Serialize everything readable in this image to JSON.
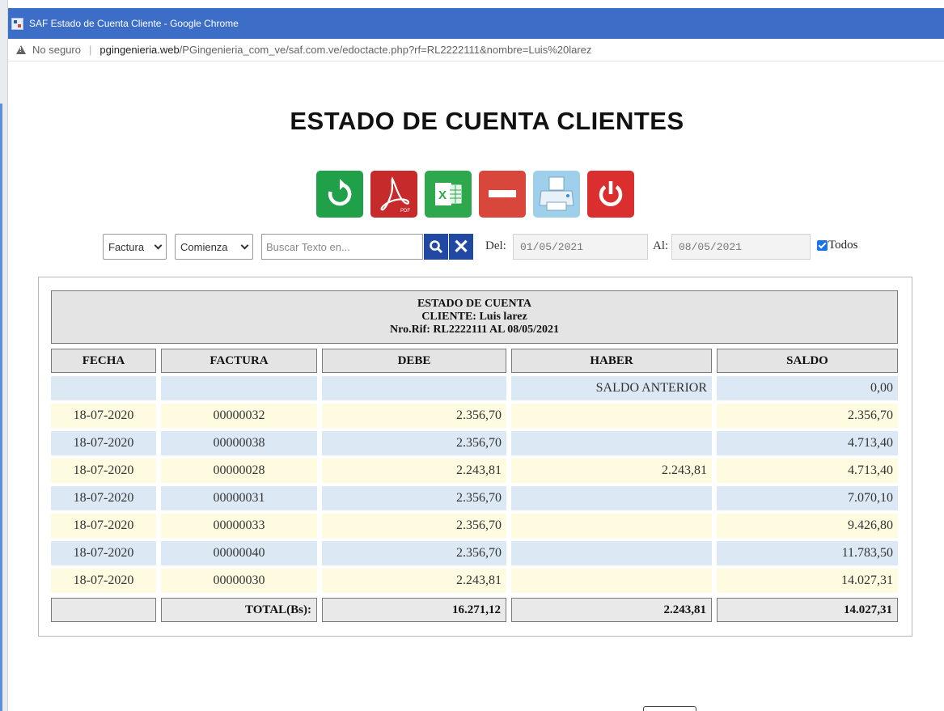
{
  "window": {
    "title": "SAF Estado de Cuenta Cliente - Google Chrome",
    "security": "No seguro",
    "url_host": "pgingenieria.web",
    "url_path": "/PGingenieria_com_ve/saf.com.ve/edoctacte.php?rf=RL2222111&nombre=Luis%20larez"
  },
  "page": {
    "title": "ESTADO DE CUENTA CLIENTES"
  },
  "toolbar": {
    "buttons": [
      "refresh-icon",
      "pdf-icon",
      "excel-icon",
      "minus-icon",
      "print-icon",
      "power-icon"
    ],
    "colors": {
      "refresh": "#21a04a",
      "pdf": "#c62a2b",
      "excel": "#2ea84d",
      "minus": "#d9463c",
      "print": "#9ed0ec",
      "power": "#db2f2f"
    }
  },
  "filters": {
    "doc_type": "Factura",
    "match_mode": "Comienza",
    "search_placeholder": "Buscar Texto en...",
    "from_label": "Del:",
    "from_date": "01/05/2021",
    "to_label": "Al:",
    "to_date": "08/05/2021",
    "all_checked": true,
    "all_label": "Todos"
  },
  "report": {
    "header_line1": "ESTADO DE CUENTA",
    "header_line2": "CLIENTE: Luis larez",
    "header_line3": "Nro.Rif: RL2222111 AL 08/05/2021",
    "columns": [
      "FECHA",
      "FACTURA",
      "DEBE",
      "HABER",
      "SALDO"
    ],
    "opening_label": "SALDO ANTERIOR",
    "opening_balance": "0,00",
    "rows": [
      {
        "fecha": "18-07-2020",
        "factura": "00000032",
        "debe": "2.356,70",
        "haber": "",
        "saldo": "2.356,70"
      },
      {
        "fecha": "18-07-2020",
        "factura": "00000038",
        "debe": "2.356,70",
        "haber": "",
        "saldo": "4.713,40"
      },
      {
        "fecha": "18-07-2020",
        "factura": "00000028",
        "debe": "2.243,81",
        "haber": "2.243,81",
        "saldo": "4.713,40"
      },
      {
        "fecha": "18-07-2020",
        "factura": "00000031",
        "debe": "2.356,70",
        "haber": "",
        "saldo": "7.070,10"
      },
      {
        "fecha": "18-07-2020",
        "factura": "00000033",
        "debe": "2.356,70",
        "haber": "",
        "saldo": "9.426,80"
      },
      {
        "fecha": "18-07-2020",
        "factura": "00000040",
        "debe": "2.356,70",
        "haber": "",
        "saldo": "11.783,50"
      },
      {
        "fecha": "18-07-2020",
        "factura": "00000030",
        "debe": "2.243,81",
        "haber": "",
        "saldo": "14.027,31"
      }
    ],
    "total_label": "TOTAL(Bs):",
    "total_debe": "16.271,12",
    "total_haber": "2.243,81",
    "total_saldo": "14.027,31",
    "row_colors": {
      "odd": "#fffbe0",
      "even": "#dce9f5"
    }
  }
}
